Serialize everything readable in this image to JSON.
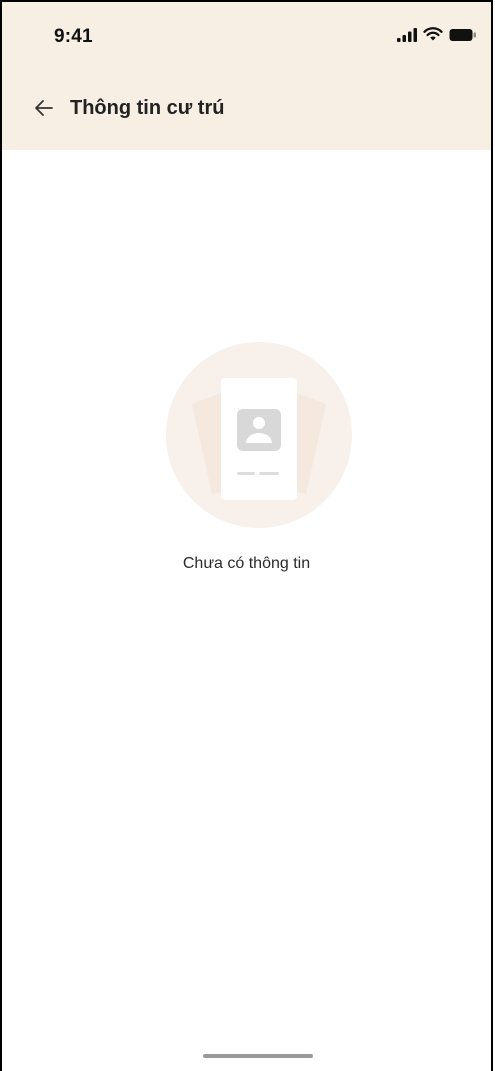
{
  "status_bar": {
    "time": "9:41",
    "icons": [
      "cellular-signal-icon",
      "wifi-icon",
      "battery-icon"
    ]
  },
  "header": {
    "title": "Thông tin cư trú",
    "back_icon": "arrow-left-icon",
    "background_color": "#f8efe4"
  },
  "empty_state": {
    "illustration_icon": "id-card-icon",
    "message": "Chưa có thông tin"
  }
}
